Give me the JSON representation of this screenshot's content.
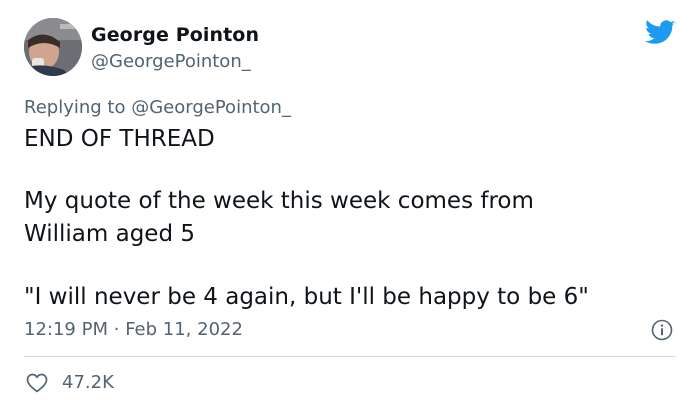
{
  "author": {
    "display_name": "George Pointon",
    "handle": "@GeorgePointon_"
  },
  "reply": {
    "prefix": "Replying to",
    "mention": "@GeorgePointon_"
  },
  "tweet": {
    "line1": "END OF THREAD",
    "line2": "My quote of the week this week comes from",
    "line3": "William aged 5",
    "line4": "\"I will never be 4 again, but I'll be happy to be 6\""
  },
  "meta": {
    "time": "12:19 PM",
    "separator": "·",
    "date": "Feb 11, 2022"
  },
  "engagement": {
    "likes": "47.2K"
  },
  "icons": {
    "brand": "twitter-bird-icon",
    "info": "info-icon",
    "like": "heart-icon"
  },
  "colors": {
    "brand": "#1d9bf0",
    "text": "#0f1419",
    "secondary": "#536471",
    "divider": "#cfd9de"
  }
}
